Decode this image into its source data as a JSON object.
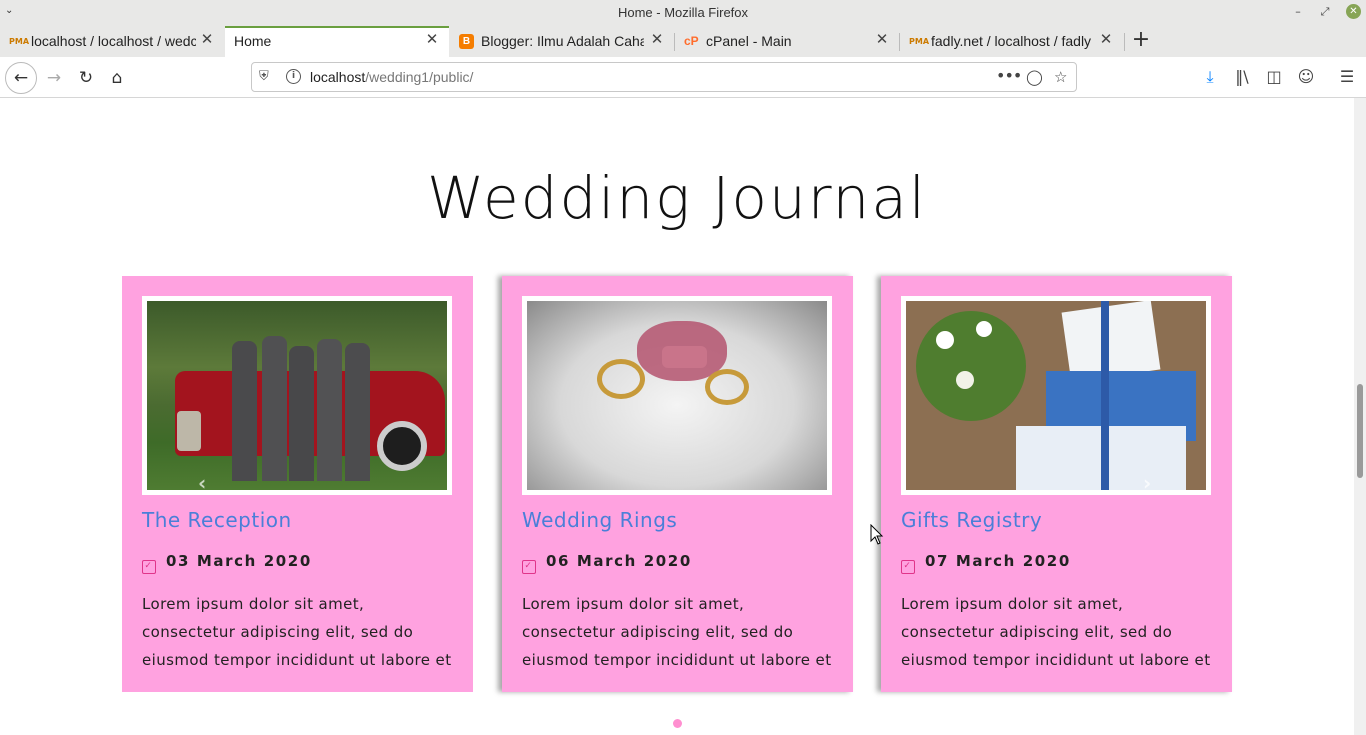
{
  "window": {
    "title": "Home - Mozilla Firefox"
  },
  "tabs": [
    {
      "label": "localhost / localhost / wedc",
      "icon": "phpmyadmin-icon"
    },
    {
      "label": "Home",
      "icon": "",
      "active": true
    },
    {
      "label": "Blogger: Ilmu Adalah Cahay",
      "icon": "blogger-icon"
    },
    {
      "label": "cPanel - Main",
      "icon": "cpanel-icon"
    },
    {
      "label": "fadly.net / localhost / fadly",
      "icon": "phpmyadmin-icon"
    }
  ],
  "navbar": {
    "url_host": "localhost",
    "url_path": "/wedding1/public/"
  },
  "page": {
    "heading": "Wedding Journal",
    "cards": [
      {
        "title": "The Reception",
        "date": "03 March 2020",
        "text": "Lorem ipsum dolor sit amet, consectetur adipiscing elit, sed do eiusmod tempor incididunt ut labore et"
      },
      {
        "title": "Wedding Rings",
        "date": "06 March 2020",
        "text": "Lorem ipsum dolor sit amet, consectetur adipiscing elit, sed do eiusmod tempor incididunt ut labore et"
      },
      {
        "title": "Gifts Registry",
        "date": "07 March 2020",
        "text": "Lorem ipsum dolor sit amet, consectetur adipiscing elit, sed do eiusmod tempor incididunt ut labore et"
      }
    ]
  },
  "colors": {
    "card_bg": "#ffa2e0",
    "card_title": "#4a7fd8",
    "accent": "#e0348a"
  }
}
